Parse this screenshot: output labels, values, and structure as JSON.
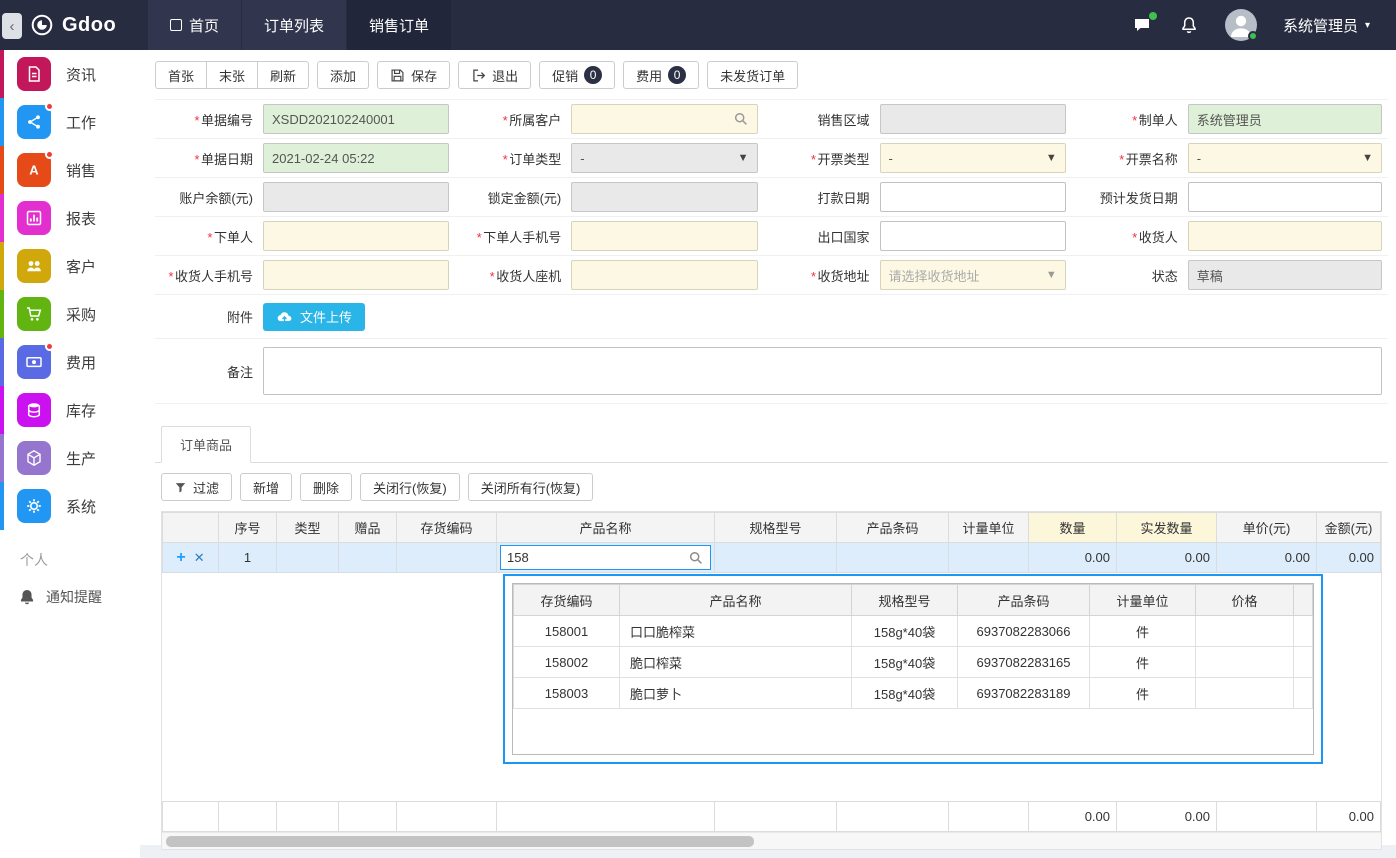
{
  "colors": {
    "navbar_bg": "#282c40",
    "navbar_tab_active": "#22263a",
    "accent_blue": "#2196f3",
    "dropdown_border": "#1a97f5",
    "upload_button": "#29b5e8",
    "badge_bg": "#2b3044",
    "field_green": "#dff0d8",
    "field_yellow": "#fcf8e3",
    "field_disabled": "#e9e9e9",
    "selected_row": "#ddedfb",
    "notification_dot": "#f23c3c",
    "online_dot": "#3fbf4e"
  },
  "navbar": {
    "brand": "Gdoo",
    "tabs": [
      "首页",
      "订单列表",
      "销售订单"
    ],
    "user": "系统管理员"
  },
  "sidebar": {
    "items": [
      {
        "label": "资讯",
        "color": "#c2185b",
        "icon": "document-icon",
        "badge": false
      },
      {
        "label": "工作",
        "color": "#2196f3",
        "icon": "share-icon",
        "badge": true
      },
      {
        "label": "销售",
        "color": "#e64a19",
        "icon": "letter-a-icon",
        "badge": true
      },
      {
        "label": "报表",
        "color": "#e42fd0",
        "icon": "bar-chart-icon",
        "badge": false
      },
      {
        "label": "客户",
        "color": "#d0a80c",
        "icon": "people-icon",
        "badge": false
      },
      {
        "label": "采购",
        "color": "#62b510",
        "icon": "cart-icon",
        "badge": false
      },
      {
        "label": "费用",
        "color": "#5a69e4",
        "icon": "banknote-icon",
        "badge": true
      },
      {
        "label": "库存",
        "color": "#cb11f0",
        "icon": "database-icon",
        "badge": false
      },
      {
        "label": "生产",
        "color": "#9575cd",
        "icon": "cube-icon",
        "badge": false
      },
      {
        "label": "系统",
        "color": "#2196f3",
        "icon": "gear-icon",
        "badge": false
      }
    ],
    "personal_section": "个人",
    "notifications": "通知提醒"
  },
  "toolbar": {
    "first": "首张",
    "last": "末张",
    "refresh": "刷新",
    "add": "添加",
    "save": "保存",
    "exit": "退出",
    "promo": "促销",
    "promo_count": "0",
    "fee": "费用",
    "fee_count": "0",
    "unshipped": "未发货订单"
  },
  "form": {
    "doc_no": {
      "label": "单据编号",
      "value": "XSDD202102240001"
    },
    "customer": {
      "label": "所属客户",
      "value": ""
    },
    "sales_region": {
      "label": "销售区域",
      "value": ""
    },
    "creator": {
      "label": "制单人",
      "value": "系统管理员"
    },
    "doc_date": {
      "label": "单据日期",
      "value": "2021-02-24 05:22"
    },
    "order_type": {
      "label": "订单类型",
      "value": "-"
    },
    "invoice_type": {
      "label": "开票类型",
      "value": "-"
    },
    "invoice_name": {
      "label": "开票名称",
      "value": "-"
    },
    "balance": {
      "label": "账户余额(元)",
      "value": ""
    },
    "locked_amount": {
      "label": "锁定金额(元)",
      "value": ""
    },
    "pay_date": {
      "label": "打款日期",
      "value": ""
    },
    "expect_ship_date": {
      "label": "预计发货日期",
      "value": ""
    },
    "orderer": {
      "label": "下单人",
      "value": ""
    },
    "orderer_phone": {
      "label": "下单人手机号",
      "value": ""
    },
    "export_country": {
      "label": "出口国家",
      "value": ""
    },
    "consignee": {
      "label": "收货人",
      "value": ""
    },
    "consignee_phone": {
      "label": "收货人手机号",
      "value": ""
    },
    "consignee_tel": {
      "label": "收货人座机",
      "value": ""
    },
    "address": {
      "label": "收货地址",
      "placeholder": "请选择收货地址"
    },
    "status": {
      "label": "状态",
      "value": "草稿"
    },
    "attachment": {
      "label": "附件",
      "upload": "文件上传"
    },
    "remark": {
      "label": "备注",
      "value": ""
    }
  },
  "grid": {
    "tab": "订单商品",
    "buttons": {
      "filter": "过滤",
      "new": "新增",
      "delete": "删除",
      "close_row": "关闭行(恢复)",
      "close_all": "关闭所有行(恢复)"
    },
    "headers": [
      "序号",
      "类型",
      "赠品",
      "存货编码",
      "产品名称",
      "规格型号",
      "产品条码",
      "计量单位",
      "数量",
      "实发数量",
      "单价(元)",
      "金额(元)"
    ],
    "row": {
      "seq": "1",
      "search": "158",
      "qty": "0.00",
      "shipped": "0.00",
      "price": "0.00",
      "amount": "0.00"
    },
    "footer": {
      "qty": "0.00",
      "shipped": "0.00",
      "amount": "0.00"
    }
  },
  "dropdown": {
    "headers": [
      "存货编码",
      "产品名称",
      "规格型号",
      "产品条码",
      "计量单位",
      "价格"
    ],
    "rows": [
      [
        "158001",
        "口口脆榨菜",
        "158g*40袋",
        "6937082283066",
        "件",
        ""
      ],
      [
        "158002",
        "脆口榨菜",
        "158g*40袋",
        "6937082283165",
        "件",
        ""
      ],
      [
        "158003",
        "脆口萝卜",
        "158g*40袋",
        "6937082283189",
        "件",
        ""
      ]
    ]
  }
}
